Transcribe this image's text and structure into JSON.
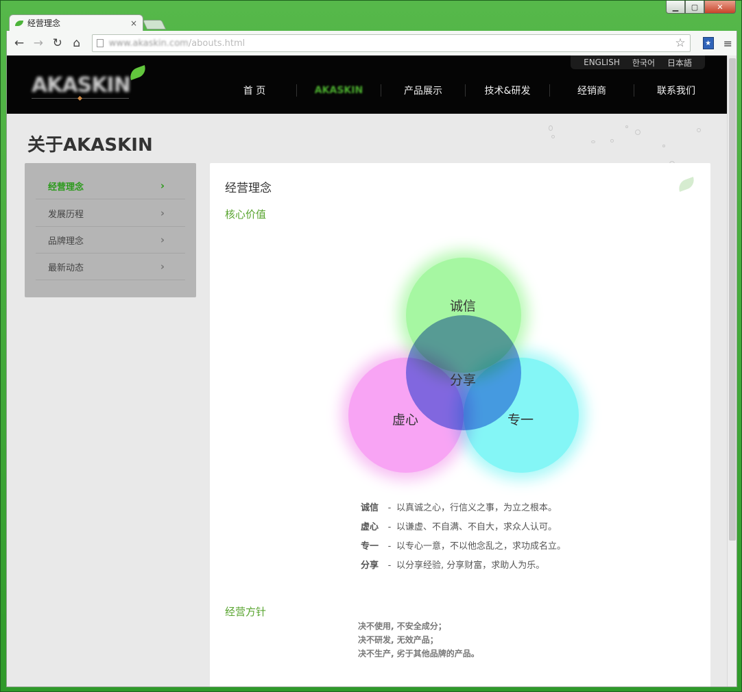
{
  "browser": {
    "tab_title": "经营理念",
    "tab_close": "×",
    "url_host": "www.akaskin.com",
    "url_path": "/abouts.html",
    "window_buttons": [
      "▁",
      "▢",
      "✕"
    ],
    "nav_icons": {
      "back": "←",
      "forward": "→",
      "reload": "↻",
      "home": "⌂",
      "star": "☆",
      "menu": "≡"
    }
  },
  "site": {
    "logo_text": "AKASKIN",
    "languages": [
      "ENGLISH",
      "한국어",
      "日本語"
    ],
    "nav": [
      "首 页",
      "AKASKIN",
      "产品展示",
      "技术&研发",
      "经销商",
      "联系我们"
    ],
    "nav_active_index": 1
  },
  "page": {
    "title": "关于AKASKIN",
    "sidebar": [
      {
        "label": "经营理念",
        "active": true
      },
      {
        "label": "发展历程",
        "active": false
      },
      {
        "label": "品牌理念",
        "active": false
      },
      {
        "label": "最新动态",
        "active": false
      }
    ],
    "sidebar_arrow": "›",
    "card_title": "经营理念",
    "core_values_title": "核心价值",
    "venn": {
      "top": "诚信",
      "left": "虚心",
      "right": "专一",
      "center": "分享"
    },
    "values": [
      {
        "name": "诚信",
        "text": "以真诚之心，行信义之事，为立之根本。"
      },
      {
        "name": "虚心",
        "text": "以谦虚、不自满、不自大，求众人认可。"
      },
      {
        "name": "专一",
        "text": "以专心一意，不以他念乱之，求功成名立。"
      },
      {
        "name": "分享",
        "text": "以分享经验, 分享财富，求助人为乐。"
      }
    ],
    "value_dash": "-",
    "policy_title": "经营方针",
    "policy_lines": [
      "决不使用, 不安全成分；",
      "决不研发, 无效产品；",
      "决不生产, 劣于其他品牌的产品。"
    ]
  },
  "colors": {
    "accent_green": "#58a42f",
    "header_black": "#050505"
  }
}
